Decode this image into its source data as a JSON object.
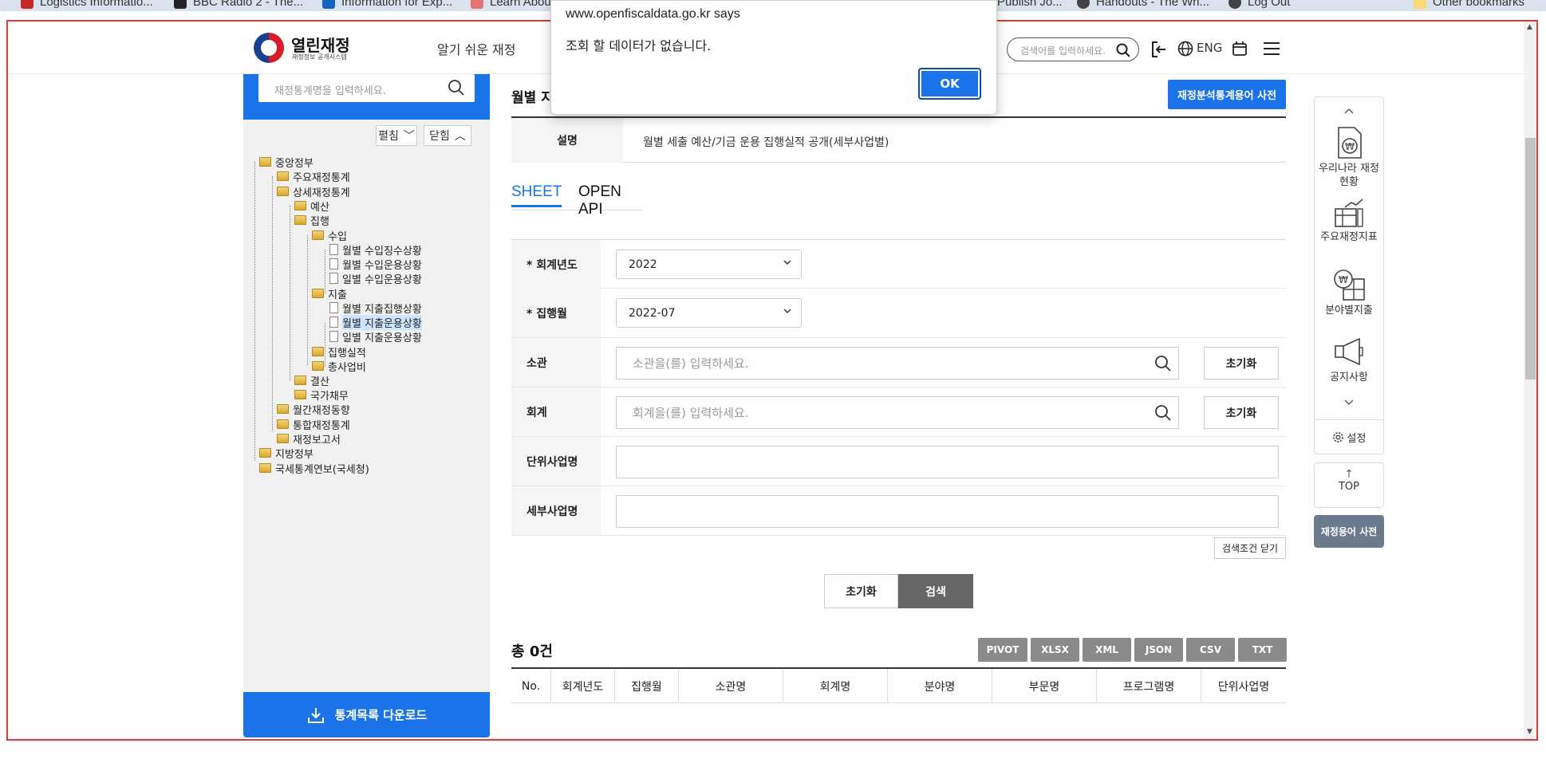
{
  "bookmarks": [
    {
      "label": "Logistics Informatio...",
      "color": "#c62828"
    },
    {
      "label": "BBC Radio 2 - The...",
      "color": "#222222"
    },
    {
      "label": "Information for Exp...",
      "color": "#1565c0"
    },
    {
      "label": "Learn Abou",
      "color": "#e57373"
    },
    {
      "label": "Publish Jo...",
      "color": "#9e9e9e"
    },
    {
      "label": "Handouts - The Wri...",
      "color": "#424242"
    },
    {
      "label": "Log Out",
      "color": "#424242"
    },
    {
      "label": "Other bookmarks",
      "color": "#f9d976"
    }
  ],
  "header": {
    "logo_title": "열린재정",
    "logo_subtitle": "재정정보 공개시스템",
    "nav_easy": "알기 쉬운 재정",
    "search_placeholder": "검색어를 입력하세요.",
    "lang": "ENG"
  },
  "sidebar": {
    "search_placeholder": "재정통계명을 입력하세요.",
    "expand_label": "펼침",
    "collapse_label": "닫힘",
    "tree": [
      {
        "label": "중앙정부",
        "type": "folder",
        "level": 0
      },
      {
        "label": "주요재정통계",
        "type": "folder",
        "level": 1
      },
      {
        "label": "상세재정통계",
        "type": "folder",
        "level": 1
      },
      {
        "label": "예산",
        "type": "folder",
        "level": 2
      },
      {
        "label": "집행",
        "type": "folder",
        "level": 2
      },
      {
        "label": "수입",
        "type": "folder",
        "level": 3
      },
      {
        "label": "월별 수입징수상황",
        "type": "doc",
        "level": 4
      },
      {
        "label": "월별 수입운용상황",
        "type": "doc",
        "level": 4
      },
      {
        "label": "일별 수입운용상황",
        "type": "doc",
        "level": 4
      },
      {
        "label": "지출",
        "type": "folder",
        "level": 3
      },
      {
        "label": "월별 지출집행상황",
        "type": "doc",
        "level": 4
      },
      {
        "label": "월별 지출운용상황",
        "type": "doc",
        "level": 4,
        "selected": true
      },
      {
        "label": "일별 지출운용상황",
        "type": "doc",
        "level": 4
      },
      {
        "label": "집행실적",
        "type": "folder",
        "level": 3
      },
      {
        "label": "총사업비",
        "type": "folder",
        "level": 3
      },
      {
        "label": "결산",
        "type": "folder",
        "level": 2
      },
      {
        "label": "국가채무",
        "type": "folder",
        "level": 2
      },
      {
        "label": "월간재정동향",
        "type": "folder",
        "level": 1
      },
      {
        "label": "통합재정통계",
        "type": "folder",
        "level": 1
      },
      {
        "label": "재정보고서",
        "type": "folder",
        "level": 1
      },
      {
        "label": "지방정부",
        "type": "folder",
        "level": 0
      },
      {
        "label": "국세통계연보(국세청)",
        "type": "folder",
        "level": 0
      }
    ],
    "download_label": "통계목록 다운로드"
  },
  "main": {
    "title": "월별 지",
    "dict_button": "재정분석통계용어 사전",
    "desc_label": "설명",
    "desc_value": "월별 세출 예산/기금 운용 집행실적 공개(세부사업별)",
    "tabs": [
      "SHEET",
      "OPEN API"
    ],
    "form": {
      "fiscal_year_label": "* 회계년도",
      "fiscal_year_value": "2022",
      "exec_month_label": "* 집행월",
      "exec_month_value": "2022-07",
      "ministry_label": "소관",
      "ministry_placeholder": "소관을(를) 입력하세요.",
      "account_label": "회계",
      "account_placeholder": "회계을(를) 입력하세요.",
      "unit_project_label": "단위사업명",
      "detail_project_label": "세부사업명",
      "reset_small": "초기화"
    },
    "close_conditions": "검색조건 닫기",
    "reset_button": "초기화",
    "search_button": "검색",
    "total": "총 0건",
    "exports": [
      "PIVOT",
      "XLSX",
      "XML",
      "JSON",
      "CSV",
      "TXT"
    ],
    "columns": [
      "No.",
      "회계년도",
      "집행월",
      "소관명",
      "회계명",
      "분야명",
      "부문명",
      "프로그램명",
      "단위사업명"
    ]
  },
  "quick_menu": {
    "items": [
      "우리나라 재정 현황",
      "주요재정지표",
      "분야별지출",
      "공지사항"
    ],
    "settings": "설정",
    "top": "TOP",
    "term_dict": "재정용어 사전"
  },
  "dialog": {
    "title": "www.openfiscaldata.go.kr says",
    "message": "조회 할 데이터가 없습니다.",
    "ok": "OK"
  }
}
